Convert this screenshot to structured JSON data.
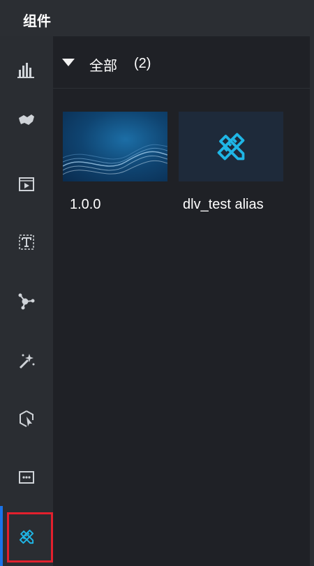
{
  "panel": {
    "title": "组件"
  },
  "sidebar": {
    "items": [
      {
        "icon": "bar-chart-icon"
      },
      {
        "icon": "map-icon"
      },
      {
        "icon": "media-icon"
      },
      {
        "icon": "text-icon"
      },
      {
        "icon": "relation-network-icon"
      },
      {
        "icon": "magic-wand-icon"
      },
      {
        "icon": "interaction-cursor-icon"
      },
      {
        "icon": "more-icon"
      },
      {
        "icon": "custom-tools-icon",
        "active": true,
        "highlight_color": "#e2202d"
      }
    ]
  },
  "group": {
    "label": "全部",
    "count": "(2)"
  },
  "cards": [
    {
      "label": "1.0.0",
      "thumbnail": "blue-wave-image"
    },
    {
      "label": "dlv_test alias",
      "thumbnail": "pencil-ruler-icon"
    }
  ],
  "colors": {
    "background": "#1f2126",
    "sidebar": "#2a2d32",
    "accent": "#1a73e8",
    "icon_cyan": "#1fb6e6",
    "highlight": "#e2202d"
  }
}
